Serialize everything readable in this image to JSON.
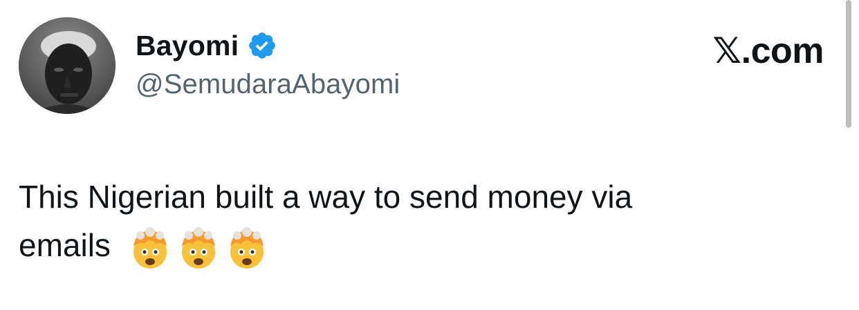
{
  "tweet": {
    "author": {
      "display_name": "Bayomi",
      "handle": "@SemudaraAbayomi",
      "verified": true,
      "verified_color": "#1d9bf0"
    },
    "brand": "𝕏.com",
    "text_line1": "This Nigerian built a way to send money via",
    "text_line2": "emails",
    "emojis": [
      "exploding-head-emoji",
      "exploding-head-emoji",
      "exploding-head-emoji"
    ],
    "colors": {
      "text": "#0f1419",
      "secondary_text": "#536471",
      "background": "#ffffff"
    }
  }
}
